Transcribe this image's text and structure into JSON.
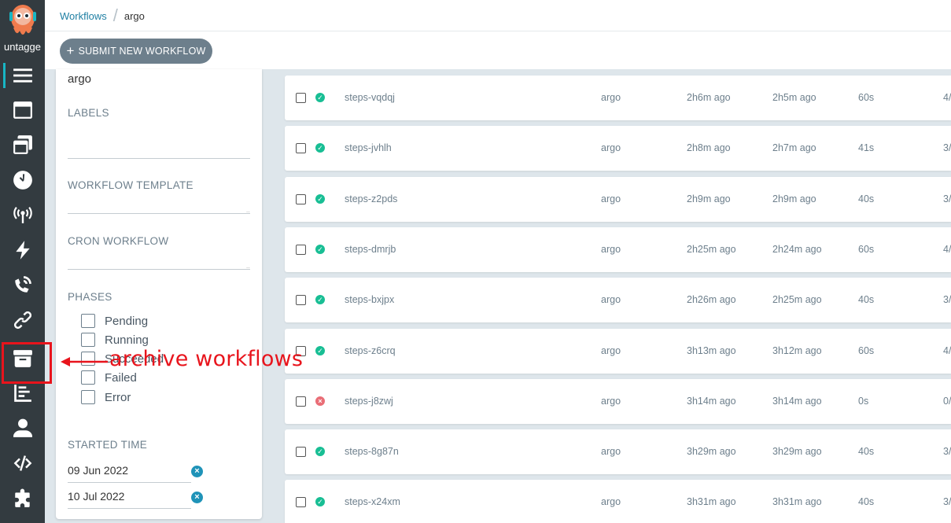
{
  "nav": {
    "namespace_label": "untagge",
    "items": [
      {
        "icon": "workflows-list-icon"
      },
      {
        "icon": "workflow-templates-icon"
      },
      {
        "icon": "cluster-workflow-templates-icon"
      },
      {
        "icon": "cron-workflows-icon"
      },
      {
        "icon": "event-sources-icon"
      },
      {
        "icon": "sensors-icon"
      },
      {
        "icon": "event-flow-icon"
      },
      {
        "icon": "link-icon"
      },
      {
        "icon": "archive-icon"
      },
      {
        "icon": "reports-icon"
      },
      {
        "icon": "user-icon"
      },
      {
        "icon": "api-docs-icon"
      },
      {
        "icon": "plugins-icon"
      }
    ]
  },
  "breadcrumb": {
    "parent": "Workflows",
    "current": "argo"
  },
  "toolbar": {
    "submit_label": "SUBMIT NEW WORKFLOW"
  },
  "filters": {
    "namespace_value": "argo",
    "labels_title": "LABELS",
    "workflow_template_title": "WORKFLOW TEMPLATE",
    "cron_workflow_title": "CRON WORKFLOW",
    "phases_title": "PHASES",
    "phases": [
      "Pending",
      "Running",
      "Succeeded",
      "Failed",
      "Error"
    ],
    "started_time_title": "STARTED TIME",
    "date_from": "09 Jun 2022",
    "date_to": "10 Jul 2022"
  },
  "workflows": [
    {
      "name": "steps-vqdqj",
      "namespace": "argo",
      "started": "2h6m ago",
      "finished": "2h5m ago",
      "duration": "60s",
      "progress": "4/",
      "status": "succeeded"
    },
    {
      "name": "steps-jvhlh",
      "namespace": "argo",
      "started": "2h8m ago",
      "finished": "2h7m ago",
      "duration": "41s",
      "progress": "3/",
      "status": "succeeded"
    },
    {
      "name": "steps-z2pds",
      "namespace": "argo",
      "started": "2h9m ago",
      "finished": "2h9m ago",
      "duration": "40s",
      "progress": "3/",
      "status": "succeeded"
    },
    {
      "name": "steps-dmrjb",
      "namespace": "argo",
      "started": "2h25m ago",
      "finished": "2h24m ago",
      "duration": "60s",
      "progress": "4/",
      "status": "succeeded"
    },
    {
      "name": "steps-bxjpx",
      "namespace": "argo",
      "started": "2h26m ago",
      "finished": "2h25m ago",
      "duration": "40s",
      "progress": "3/",
      "status": "succeeded"
    },
    {
      "name": "steps-z6crq",
      "namespace": "argo",
      "started": "3h13m ago",
      "finished": "3h12m ago",
      "duration": "60s",
      "progress": "4/",
      "status": "succeeded"
    },
    {
      "name": "steps-j8zwj",
      "namespace": "argo",
      "started": "3h14m ago",
      "finished": "3h14m ago",
      "duration": "0s",
      "progress": "0/",
      "status": "failed"
    },
    {
      "name": "steps-8g87n",
      "namespace": "argo",
      "started": "3h29m ago",
      "finished": "3h29m ago",
      "duration": "40s",
      "progress": "3/",
      "status": "succeeded"
    },
    {
      "name": "steps-x24xm",
      "namespace": "argo",
      "started": "3h31m ago",
      "finished": "3h31m ago",
      "duration": "40s",
      "progress": "3/",
      "status": "succeeded"
    }
  ],
  "annotation": {
    "text": "archive workflows",
    "color": "#e8141c"
  },
  "colors": {
    "nav_bg": "#333b40",
    "accent": "#18b6c4",
    "success": "#18be94",
    "failure": "#e96d76",
    "button": "#6d7f8c"
  }
}
